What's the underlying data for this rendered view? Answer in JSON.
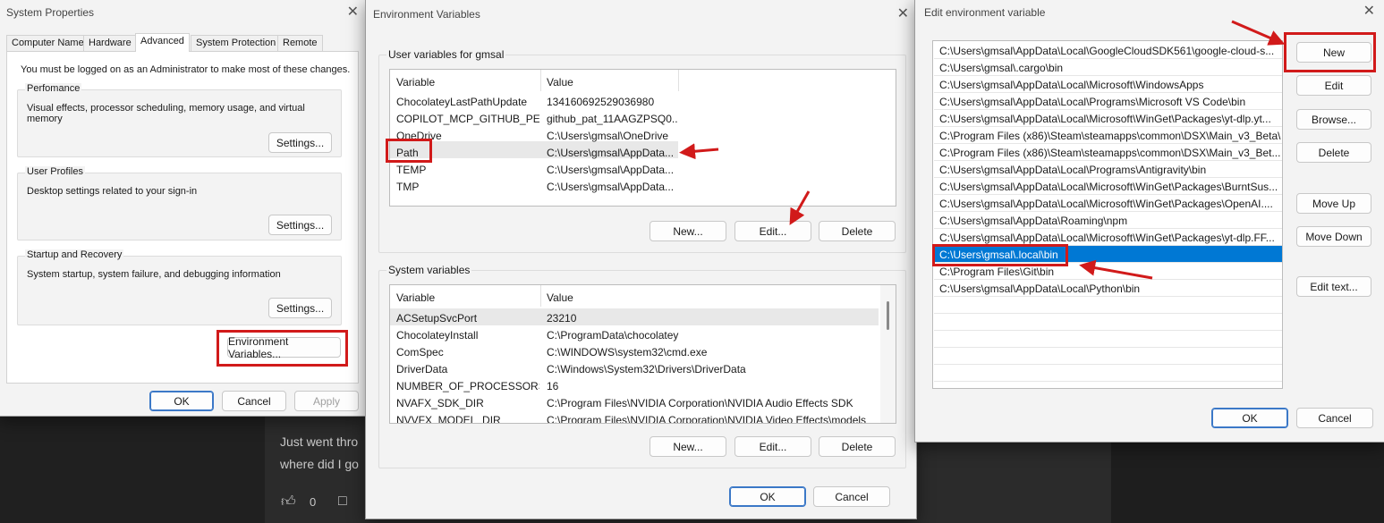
{
  "background": {
    "line1": "Just went thro",
    "line2": "where did I go",
    "count": "0"
  },
  "system_properties": {
    "title": "System Properties",
    "tabs": [
      {
        "label": "Computer Name"
      },
      {
        "label": "Hardware"
      },
      {
        "label": "Advanced"
      },
      {
        "label": "System Protection"
      },
      {
        "label": "Remote"
      }
    ],
    "admin_note": "You must be logged on as an Administrator to make most of these changes.",
    "performance": {
      "title": "Perfomance",
      "desc": "Visual effects, processor scheduling, memory usage, and virtual memory",
      "button": "Settings..."
    },
    "user_profiles": {
      "title": "User Profiles",
      "desc": "Desktop settings related to your sign-in",
      "button": "Settings..."
    },
    "startup": {
      "title": "Startup and Recovery",
      "desc": "System startup, system failure, and debugging information",
      "button": "Settings..."
    },
    "env_button": "Environment Variables...",
    "ok": "OK",
    "cancel": "Cancel",
    "apply": "Apply"
  },
  "env_vars": {
    "title": "Environment Variables",
    "user_group": "User variables for gmsal",
    "col_variable": "Variable",
    "col_value": "Value",
    "user_rows": [
      {
        "name": "ChocolateyLastPathUpdate",
        "value": "134160692529036980"
      },
      {
        "name": "COPILOT_MCP_GITHUB_PER...",
        "value": "github_pat_11AAGZPSQ0..."
      },
      {
        "name": "OneDrive",
        "value": "C:\\Users\\gmsal\\OneDrive"
      },
      {
        "name": "Path",
        "value": "C:\\Users\\gmsal\\AppData..."
      },
      {
        "name": "TEMP",
        "value": "C:\\Users\\gmsal\\AppData..."
      },
      {
        "name": "TMP",
        "value": "C:\\Users\\gmsal\\AppData..."
      }
    ],
    "user_new": "New...",
    "user_edit": "Edit...",
    "user_delete": "Delete",
    "system_group": "System variables",
    "system_rows": [
      {
        "name": "ACSetupSvcPort",
        "value": "23210"
      },
      {
        "name": "ChocolateyInstall",
        "value": "C:\\ProgramData\\chocolatey"
      },
      {
        "name": "ComSpec",
        "value": "C:\\WINDOWS\\system32\\cmd.exe"
      },
      {
        "name": "DriverData",
        "value": "C:\\Windows\\System32\\Drivers\\DriverData"
      },
      {
        "name": "NUMBER_OF_PROCESSORS",
        "value": "16"
      },
      {
        "name": "NVAFX_SDK_DIR",
        "value": "C:\\Program Files\\NVIDIA Corporation\\NVIDIA Audio Effects SDK"
      },
      {
        "name": "NVVFX_MODEL_DIR",
        "value": "C:\\Program Files\\NVIDIA Corporation\\NVIDIA Video Effects\\models"
      }
    ],
    "sys_new": "New...",
    "sys_edit": "Edit...",
    "sys_delete": "Delete",
    "ok": "OK",
    "cancel": "Cancel"
  },
  "edit_env": {
    "title": "Edit environment variable",
    "paths": [
      "C:\\Users\\gmsal\\AppData\\Local\\GoogleCloudSDK561\\google-cloud-s...",
      "C:\\Users\\gmsal\\.cargo\\bin",
      "C:\\Users\\gmsal\\AppData\\Local\\Microsoft\\WindowsApps",
      "C:\\Users\\gmsal\\AppData\\Local\\Programs\\Microsoft VS Code\\bin",
      "C:\\Users\\gmsal\\AppData\\Local\\Microsoft\\WinGet\\Packages\\yt-dlp.yt...",
      "C:\\Program Files (x86)\\Steam\\steamapps\\common\\DSX\\Main_v3_Beta\\",
      "C:\\Program Files (x86)\\Steam\\steamapps\\common\\DSX\\Main_v3_Bet...",
      "C:\\Users\\gmsal\\AppData\\Local\\Programs\\Antigravity\\bin",
      "C:\\Users\\gmsal\\AppData\\Local\\Microsoft\\WinGet\\Packages\\BurntSus...",
      "C:\\Users\\gmsal\\AppData\\Local\\Microsoft\\WinGet\\Packages\\OpenAI....",
      "C:\\Users\\gmsal\\AppData\\Roaming\\npm",
      "C:\\Users\\gmsal\\AppData\\Local\\Microsoft\\WinGet\\Packages\\yt-dlp.FF...",
      "C:\\Users\\gmsal\\.local\\bin",
      "C:\\Program Files\\Git\\bin",
      "C:\\Users\\gmsal\\AppData\\Local\\Python\\bin"
    ],
    "selected_index": 12,
    "new": "New",
    "edit": "Edit",
    "browse": "Browse...",
    "delete": "Delete",
    "move_up": "Move Up",
    "move_down": "Move Down",
    "edit_text": "Edit text...",
    "ok": "OK",
    "cancel": "Cancel"
  },
  "annotation_color": "#d11a1a",
  "selection_color": "#0078d4"
}
